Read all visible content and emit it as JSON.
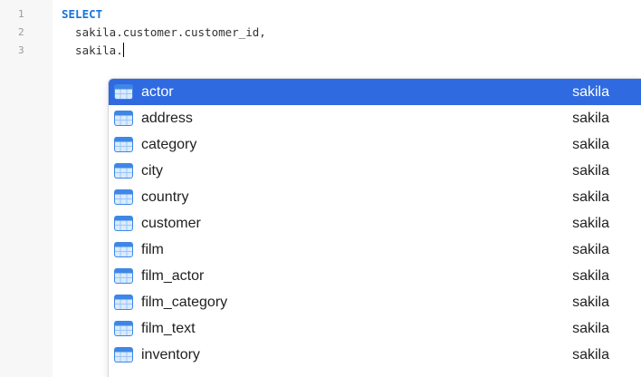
{
  "editor": {
    "lines": [
      {
        "number": "1",
        "text": "SELECT"
      },
      {
        "number": "2",
        "text": "  sakila.customer.customer_id,"
      },
      {
        "number": "3",
        "text": "  sakila."
      }
    ]
  },
  "autocomplete": {
    "icon": "table-icon",
    "selected_index": 0,
    "items": [
      {
        "name": "actor",
        "schema": "sakila"
      },
      {
        "name": "address",
        "schema": "sakila"
      },
      {
        "name": "category",
        "schema": "sakila"
      },
      {
        "name": "city",
        "schema": "sakila"
      },
      {
        "name": "country",
        "schema": "sakila"
      },
      {
        "name": "customer",
        "schema": "sakila"
      },
      {
        "name": "film",
        "schema": "sakila"
      },
      {
        "name": "film_actor",
        "schema": "sakila"
      },
      {
        "name": "film_category",
        "schema": "sakila"
      },
      {
        "name": "film_text",
        "schema": "sakila"
      },
      {
        "name": "inventory",
        "schema": "sakila"
      }
    ]
  },
  "colors": {
    "keyword": "#1a73d9",
    "selection": "#2f6ae0",
    "gutter": "#f7f7f7"
  }
}
